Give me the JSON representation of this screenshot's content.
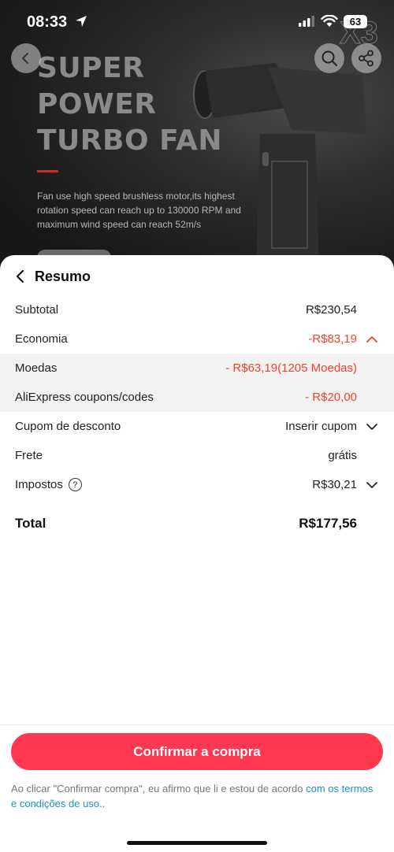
{
  "status_bar": {
    "time": "08:33",
    "battery": "63"
  },
  "hero": {
    "title": "SUPER\nPOWER\nTURBO FAN",
    "description": "Fan use high speed brushless motor,its highest rotation speed can reach up to 130000 RPM and maximum wind speed can reach 52m/s",
    "badge_text": "X3",
    "accent_color": "#d02b2b"
  },
  "icons": {
    "back": "chevron-left-icon",
    "search": "search-icon",
    "share": "share-icon",
    "expand_up": "chevron-up-icon",
    "expand_down": "chevron-down-icon",
    "help": "question-circle-icon"
  },
  "summary": {
    "title": "Resumo",
    "rows": {
      "subtotal": {
        "label": "Subtotal",
        "value": "R$230,54"
      },
      "economia": {
        "label": "Economia",
        "value": "-R$83,19"
      },
      "moedas": {
        "label": "Moedas",
        "value": "- R$63,19(1205 Moedas)"
      },
      "coupons": {
        "label": "AliExpress coupons/codes",
        "value": "- R$20,00"
      },
      "cupom": {
        "label": "Cupom de desconto",
        "value": "Inserir cupom"
      },
      "frete": {
        "label": "Frete",
        "value": "grátis"
      },
      "impostos": {
        "label": "Impostos",
        "value": "R$30,21",
        "help": "?"
      }
    },
    "total": {
      "label": "Total",
      "value": "R$177,56"
    }
  },
  "confirm_button": {
    "label": "Confirmar a compra",
    "color": "#fd384f"
  },
  "terms": {
    "text": "Ao clicar \"Confirmar compra\", eu afirmo que li e estou de acordo ",
    "link": "com os termos e condições de uso.."
  },
  "colors": {
    "discount_red": "#f0442c",
    "link_blue": "#1a90c8"
  }
}
